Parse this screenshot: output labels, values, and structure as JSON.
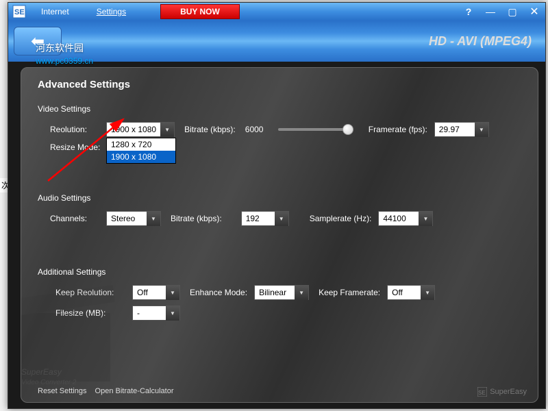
{
  "titlebar": {
    "menu_internet": "Internet",
    "menu_settings": "Settings",
    "buy_now": "BUY NOW"
  },
  "header": {
    "format": "HD - AVI (MPEG4)"
  },
  "watermark": {
    "text": "河东软件园",
    "url": "www.pc0359.cn"
  },
  "panel": {
    "title": "Advanced Settings",
    "video": {
      "group": "Video Settings",
      "resolution_label": "Reolution:",
      "resolution_value": "1900 x 1080",
      "resolution_options": [
        "1280 x 720",
        "1900 x 1080"
      ],
      "resize_label": "Resize Mode:",
      "bitrate_label": "Bitrate (kbps):",
      "bitrate_value": "6000",
      "framerate_label": "Framerate (fps):",
      "framerate_value": "29.97"
    },
    "audio": {
      "group": "Audio Settings",
      "channels_label": "Channels:",
      "channels_value": "Stereo",
      "bitrate_label": "Bitrate (kbps):",
      "bitrate_value": "192",
      "samplerate_label": "Samplerate (Hz):",
      "samplerate_value": "44100"
    },
    "additional": {
      "group": "Additional Settings",
      "keep_res_label": "Keep Reolution:",
      "keep_res_value": "Off",
      "enhance_label": "Enhance Mode:",
      "enhance_value": "Bilinear",
      "keep_fr_label": "Keep Framerate:",
      "keep_fr_value": "Off",
      "filesize_label": "Filesize (MB):",
      "filesize_value": "-"
    },
    "footer": {
      "reset": "Reset Settings",
      "calc": "Open Bitrate-Calculator"
    },
    "brand": "SuperEasy"
  },
  "side": "次"
}
